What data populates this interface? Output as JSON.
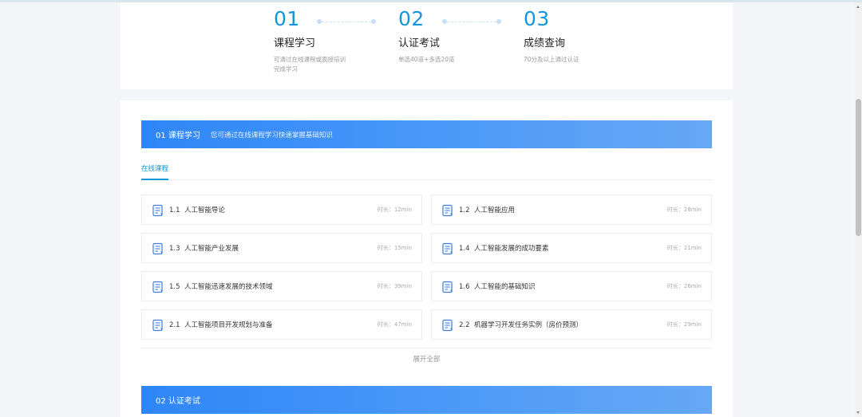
{
  "steps": [
    {
      "num": "01",
      "title": "课程学习",
      "desc": "可通过在线课程或面授培训完成学习"
    },
    {
      "num": "02",
      "title": "认证考试",
      "desc": "单选40道+多选20道"
    },
    {
      "num": "03",
      "title": "成绩查询",
      "desc": "70分及以上通过认证"
    }
  ],
  "section1": {
    "title": "01 课程学习",
    "subtitle": "您可通过在线课程学习快速掌握基础知识"
  },
  "tabs": {
    "online": "在线课程"
  },
  "duration_label": "时长：",
  "courses": [
    {
      "code": "1.1",
      "name": "人工智能导论",
      "duration": "12min"
    },
    {
      "code": "1.2",
      "name": "人工智能应用",
      "duration": "28min"
    },
    {
      "code": "1.3",
      "name": "人工智能产业发展",
      "duration": "15min"
    },
    {
      "code": "1.4",
      "name": "人工智能发展的成功要素",
      "duration": "21min"
    },
    {
      "code": "1.5",
      "name": "人工智能迅速发展的技术领域",
      "duration": "39min"
    },
    {
      "code": "1.6",
      "name": "人工智能的基础知识",
      "duration": "26min"
    },
    {
      "code": "2.1",
      "name": "人工智能项目开发规划与准备",
      "duration": "47min"
    },
    {
      "code": "2.2",
      "name": "机器学习开发任务实例（房价预测）",
      "duration": "29min"
    }
  ],
  "expand_all": "展开全部",
  "section2": {
    "title": "02 认证考试"
  },
  "colors": {
    "accent": "#1296db",
    "banner": "#3a8ef7"
  },
  "icons": {
    "course": "document-icon"
  }
}
